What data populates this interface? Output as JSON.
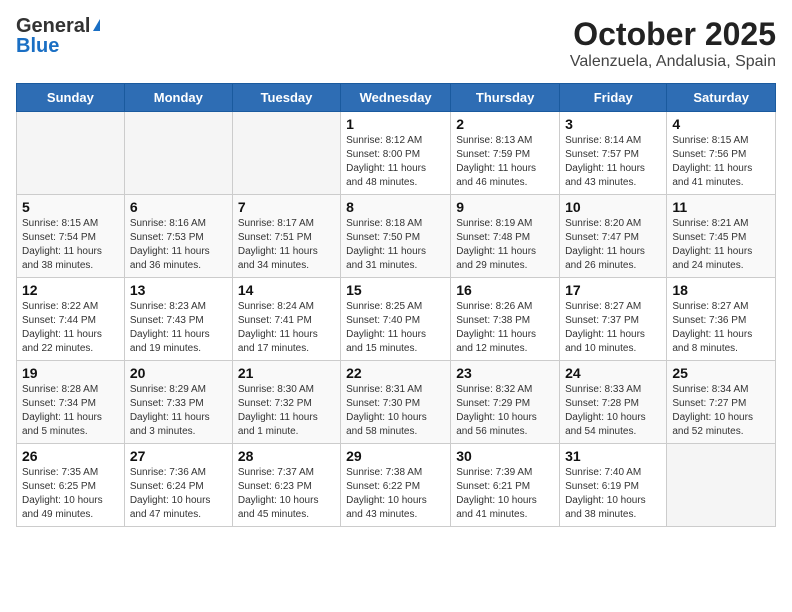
{
  "header": {
    "logo_general": "General",
    "logo_blue": "Blue",
    "title": "October 2025",
    "subtitle": "Valenzuela, Andalusia, Spain"
  },
  "weekdays": [
    "Sunday",
    "Monday",
    "Tuesday",
    "Wednesday",
    "Thursday",
    "Friday",
    "Saturday"
  ],
  "weeks": [
    [
      {
        "day": "",
        "info": ""
      },
      {
        "day": "",
        "info": ""
      },
      {
        "day": "",
        "info": ""
      },
      {
        "day": "1",
        "info": "Sunrise: 8:12 AM\nSunset: 8:00 PM\nDaylight: 11 hours\nand 48 minutes."
      },
      {
        "day": "2",
        "info": "Sunrise: 8:13 AM\nSunset: 7:59 PM\nDaylight: 11 hours\nand 46 minutes."
      },
      {
        "day": "3",
        "info": "Sunrise: 8:14 AM\nSunset: 7:57 PM\nDaylight: 11 hours\nand 43 minutes."
      },
      {
        "day": "4",
        "info": "Sunrise: 8:15 AM\nSunset: 7:56 PM\nDaylight: 11 hours\nand 41 minutes."
      }
    ],
    [
      {
        "day": "5",
        "info": "Sunrise: 8:15 AM\nSunset: 7:54 PM\nDaylight: 11 hours\nand 38 minutes."
      },
      {
        "day": "6",
        "info": "Sunrise: 8:16 AM\nSunset: 7:53 PM\nDaylight: 11 hours\nand 36 minutes."
      },
      {
        "day": "7",
        "info": "Sunrise: 8:17 AM\nSunset: 7:51 PM\nDaylight: 11 hours\nand 34 minutes."
      },
      {
        "day": "8",
        "info": "Sunrise: 8:18 AM\nSunset: 7:50 PM\nDaylight: 11 hours\nand 31 minutes."
      },
      {
        "day": "9",
        "info": "Sunrise: 8:19 AM\nSunset: 7:48 PM\nDaylight: 11 hours\nand 29 minutes."
      },
      {
        "day": "10",
        "info": "Sunrise: 8:20 AM\nSunset: 7:47 PM\nDaylight: 11 hours\nand 26 minutes."
      },
      {
        "day": "11",
        "info": "Sunrise: 8:21 AM\nSunset: 7:45 PM\nDaylight: 11 hours\nand 24 minutes."
      }
    ],
    [
      {
        "day": "12",
        "info": "Sunrise: 8:22 AM\nSunset: 7:44 PM\nDaylight: 11 hours\nand 22 minutes."
      },
      {
        "day": "13",
        "info": "Sunrise: 8:23 AM\nSunset: 7:43 PM\nDaylight: 11 hours\nand 19 minutes."
      },
      {
        "day": "14",
        "info": "Sunrise: 8:24 AM\nSunset: 7:41 PM\nDaylight: 11 hours\nand 17 minutes."
      },
      {
        "day": "15",
        "info": "Sunrise: 8:25 AM\nSunset: 7:40 PM\nDaylight: 11 hours\nand 15 minutes."
      },
      {
        "day": "16",
        "info": "Sunrise: 8:26 AM\nSunset: 7:38 PM\nDaylight: 11 hours\nand 12 minutes."
      },
      {
        "day": "17",
        "info": "Sunrise: 8:27 AM\nSunset: 7:37 PM\nDaylight: 11 hours\nand 10 minutes."
      },
      {
        "day": "18",
        "info": "Sunrise: 8:27 AM\nSunset: 7:36 PM\nDaylight: 11 hours\nand 8 minutes."
      }
    ],
    [
      {
        "day": "19",
        "info": "Sunrise: 8:28 AM\nSunset: 7:34 PM\nDaylight: 11 hours\nand 5 minutes."
      },
      {
        "day": "20",
        "info": "Sunrise: 8:29 AM\nSunset: 7:33 PM\nDaylight: 11 hours\nand 3 minutes."
      },
      {
        "day": "21",
        "info": "Sunrise: 8:30 AM\nSunset: 7:32 PM\nDaylight: 11 hours\nand 1 minute."
      },
      {
        "day": "22",
        "info": "Sunrise: 8:31 AM\nSunset: 7:30 PM\nDaylight: 10 hours\nand 58 minutes."
      },
      {
        "day": "23",
        "info": "Sunrise: 8:32 AM\nSunset: 7:29 PM\nDaylight: 10 hours\nand 56 minutes."
      },
      {
        "day": "24",
        "info": "Sunrise: 8:33 AM\nSunset: 7:28 PM\nDaylight: 10 hours\nand 54 minutes."
      },
      {
        "day": "25",
        "info": "Sunrise: 8:34 AM\nSunset: 7:27 PM\nDaylight: 10 hours\nand 52 minutes."
      }
    ],
    [
      {
        "day": "26",
        "info": "Sunrise: 7:35 AM\nSunset: 6:25 PM\nDaylight: 10 hours\nand 49 minutes."
      },
      {
        "day": "27",
        "info": "Sunrise: 7:36 AM\nSunset: 6:24 PM\nDaylight: 10 hours\nand 47 minutes."
      },
      {
        "day": "28",
        "info": "Sunrise: 7:37 AM\nSunset: 6:23 PM\nDaylight: 10 hours\nand 45 minutes."
      },
      {
        "day": "29",
        "info": "Sunrise: 7:38 AM\nSunset: 6:22 PM\nDaylight: 10 hours\nand 43 minutes."
      },
      {
        "day": "30",
        "info": "Sunrise: 7:39 AM\nSunset: 6:21 PM\nDaylight: 10 hours\nand 41 minutes."
      },
      {
        "day": "31",
        "info": "Sunrise: 7:40 AM\nSunset: 6:19 PM\nDaylight: 10 hours\nand 38 minutes."
      },
      {
        "day": "",
        "info": ""
      }
    ]
  ]
}
